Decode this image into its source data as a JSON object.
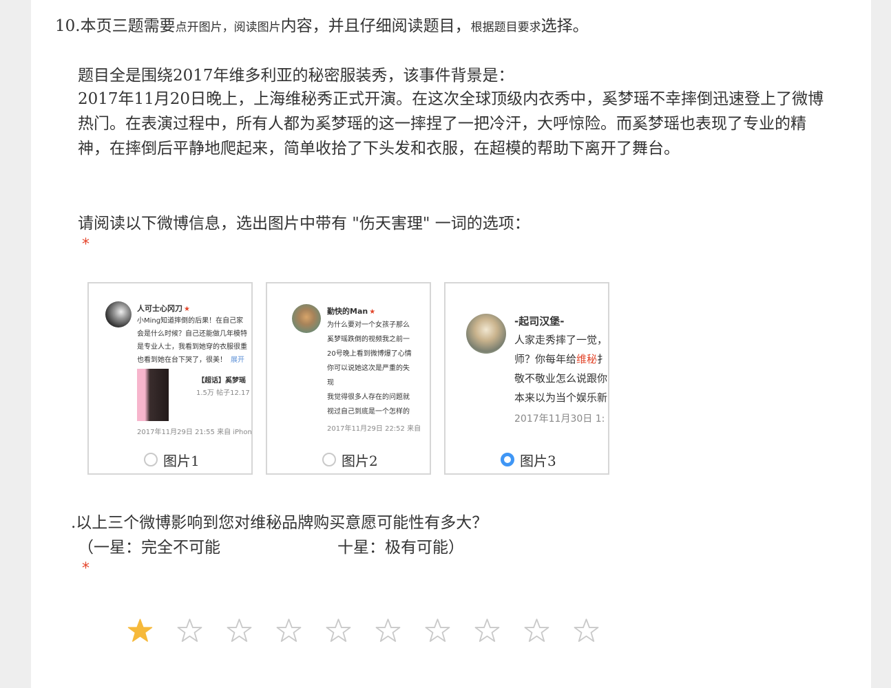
{
  "question_header": {
    "number": "10.",
    "part1": "本页三题需要",
    "part2": "点开图片，阅读图片",
    "part3": "内容，并且仔细阅读题目，",
    "part4": "根据题目要求",
    "part5": "选择。"
  },
  "background": {
    "title": "题目全是围绕2017年维多利亚的秘密服装秀，该事件背景是：",
    "body": "2017年11月20日晚上，上海维秘秀正式开演。在这次全球顶级内衣秀中，奚梦瑶不幸摔倒迅速登上了微博热门。在表演过程中，所有人都为奚梦瑶的这一摔捏了一把冷汗，大呼惊险。而奚梦瑶也表现了专业的精神，在摔倒后平静地爬起来，简单收拾了下头发和衣服，在超模的帮助下离开了舞台。"
  },
  "question1": {
    "text": "请阅读以下微博信息，选出图片中带有 \"伤天害理\" 一词的选项：",
    "required_mark": "*",
    "options": [
      {
        "label": "图片1",
        "selected": false,
        "weibo": {
          "user": "人可士心冈刀",
          "star": "★",
          "lines": [
            "小Ming知道摔倒的后果！在自己家",
            "会是什么时候？自己还能做几年模特",
            "是专业人士，我看到她穿的衣服很重",
            "也看到她在台下哭了，很美！"
          ],
          "expand": "展开",
          "topic": "【超话】奚梦瑶",
          "topic_meta": "1.5万 帖子12.17",
          "footer": "2017年11月29日 21:55 来自 iPhon"
        }
      },
      {
        "label": "图片2",
        "selected": false,
        "weibo": {
          "user": "勤快的Man",
          "star": "★",
          "lines": [
            "为什么要对一个女孩子那么",
            "奚梦瑶跌倒的视频我之前一",
            "20号晚上看到微博爆了心情",
            "你可以说她这次是严重的失",
            "现",
            "我觉得很多人存在的问题就",
            "视过自己到底是一个怎样的"
          ],
          "footer": "2017年11月29日 22:52 来自"
        }
      },
      {
        "label": "图片3",
        "selected": true,
        "weibo": {
          "user": "-起司汉堡-",
          "line1": "人家走秀摔了一觉，",
          "line2_pre": "师？你每年给",
          "line2_hl": "维秘",
          "line2_post": "扌",
          "line3": "敬不敬业怎么说跟你",
          "line4": "本来以为当个娱乐新",
          "footer": "2017年11月30日 1:"
        }
      }
    ]
  },
  "question2": {
    "text": ".以上三个微博影响到您对维秘品牌购买意愿可能性有多大？",
    "scale_left": "（一星：完全不可能",
    "scale_right": "十星：极有可能）",
    "required_mark": "*",
    "rating": 1,
    "max_rating": 10
  },
  "colors": {
    "required": "#e4442b",
    "radio_selected": "#3f96f5",
    "star_filled": "#f6b93b",
    "star_empty": "#c9c9c9",
    "weibo_highlight": "#e2452a"
  }
}
